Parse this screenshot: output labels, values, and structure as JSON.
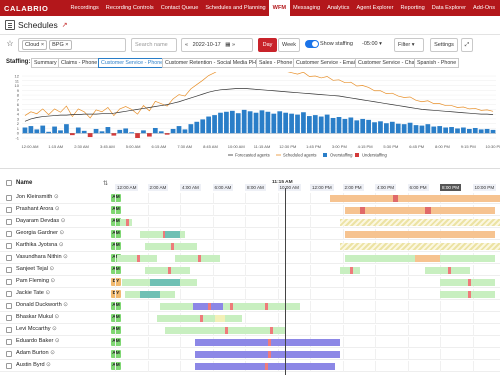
{
  "nav": {
    "logo": "CALABRIO",
    "items": [
      "Recordings",
      "Recording Controls",
      "Contact Queue",
      "Schedules and Planning",
      "WFM",
      "Messaging",
      "Analytics",
      "Agent Explorer",
      "Reporting",
      "Data Explorer",
      "Add-Ons"
    ],
    "active": "WFM"
  },
  "header": {
    "title": "Schedules",
    "ext_icon": "external-link-icon"
  },
  "toolbar": {
    "star": "☆",
    "timezone_filter": "Cloud",
    "chip_bpg": "BPG",
    "search_placeholder": "Search name",
    "date": "2022-10-17",
    "day_label": "Day",
    "week_label": "Week",
    "show_staffing_label": "Show staffing",
    "offset": "-05:00",
    "filter_label": "Filter",
    "settings_label": "Settings"
  },
  "staffing": {
    "label": "Staffing:",
    "tabs": [
      "Summary",
      "Claims - Phone",
      "Customer Service - Phone",
      "Customer Retention - Social Media PH",
      "Sales - Phone",
      "Customer Service - Email",
      "Customer Service - Chat",
      "Spanish - Phone"
    ],
    "active_tab": "Customer Service - Phone"
  },
  "chart_data": {
    "type": "bar",
    "y_ticks": [
      -1,
      0,
      1,
      2,
      3,
      4,
      5,
      6,
      7,
      8,
      9,
      10,
      11,
      12
    ],
    "ylim": [
      -1,
      12
    ],
    "x_ticks": [
      "12:00 AM",
      "1:15 AM",
      "2:30 AM",
      "3:45 AM",
      "5:00 AM",
      "6:15 AM",
      "7:30 AM",
      "8:45 AM",
      "10:00 AM",
      "11:15 AM",
      "12:30 PM",
      "1:45 PM",
      "3:00 PM",
      "4:15 PM",
      "5:30 PM",
      "6:45 PM",
      "8:00 PM",
      "9:15 PM",
      "10:30 PM"
    ],
    "legend": [
      "Forecasted agents",
      "Scheduled agents",
      "Overstaffing",
      "Understaffing"
    ],
    "colors": {
      "forecast": "#333333",
      "scheduled": "#e8902a",
      "over": "#2a7ec8",
      "under": "#d33a3a"
    },
    "forecast": [
      2.5,
      3,
      3.3,
      3.5,
      3.6,
      3.7,
      3.8,
      3.8,
      3.9,
      3.9,
      4,
      4,
      4,
      4.1,
      4.1,
      4.2,
      4.4,
      4.6,
      4.8,
      5,
      5.2,
      5.4,
      5.6,
      5.8,
      6,
      6.3,
      6.6,
      7,
      7.4,
      7.8,
      8.2,
      8.6,
      8.9,
      9.1,
      9.2,
      9.3,
      9.4,
      9.4,
      9.3,
      9.2,
      9.1,
      9,
      8.9,
      8.8,
      8.7,
      8.6,
      8.5,
      8.4,
      8.3,
      8.2,
      8.1,
      8,
      7.9,
      7.8,
      7.6,
      7.4,
      7.2,
      7,
      6.8,
      6.6,
      6.4,
      6.2,
      6,
      5.8,
      5.6,
      5.4,
      5.2,
      5,
      4.9,
      4.8,
      4.7,
      4.6,
      4.5,
      4.4,
      4.3,
      4.2,
      4.1,
      4,
      4,
      3.9
    ],
    "staffing_delta": [
      1.2,
      1.5,
      0.8,
      1.6,
      0.3,
      1.4,
      0.6,
      1.9,
      -0.4,
      1.2,
      0.5,
      -0.8,
      0.9,
      0.4,
      1.3,
      -0.5,
      0.7,
      1,
      0.2,
      -1,
      0.6,
      -0.7,
      1.1,
      0.4,
      -0.3,
      0.9,
      1.5,
      0.8,
      1.9,
      2.4,
      2.9,
      3.5,
      3.8,
      4.3,
      4.5,
      4.7,
      4.2,
      4.9,
      4.6,
      4.3,
      4.8,
      4.5,
      4.1,
      4.6,
      4.3,
      4.1,
      3.9,
      4.4,
      3.6,
      3.8,
      3.5,
      3.9,
      3.2,
      3.4,
      3,
      3.3,
      2.7,
      3,
      2.8,
      2.3,
      2.5,
      2.1,
      2.4,
      2,
      1.9,
      2.2,
      1.7,
      1.6,
      1.9,
      1.4,
      1.5,
      1.2,
      1.3,
      1,
      1.2,
      0.9,
      1.1,
      0.8,
      0.9,
      0.7
    ]
  },
  "grid": {
    "name_header": "Name",
    "current_time": "11:15 AM",
    "time_ticks": [
      {
        "label": "12:00 AM",
        "dark": false
      },
      {
        "label": "2:00 AM",
        "dark": false
      },
      {
        "label": "4:00 AM",
        "dark": false
      },
      {
        "label": "6:00 AM",
        "dark": false
      },
      {
        "label": "8:00 AM",
        "dark": false
      },
      {
        "label": "10:00 AM",
        "dark": false
      },
      {
        "label": "12:00 PM",
        "dark": false
      },
      {
        "label": "2:00 PM",
        "dark": false
      },
      {
        "label": "4:00 PM",
        "dark": false
      },
      {
        "label": "6:00 PM",
        "dark": false
      },
      {
        "label": "8:00 PM",
        "dark": false
      },
      {
        "label": "10:00 PM",
        "dark": false
      }
    ],
    "rows": [
      {
        "name": "Jon Kleinsmith",
        "badge": "AM",
        "segs": [
          [
            "b",
            330,
            150,
            "#f6c390"
          ],
          [
            "b",
            393,
            5,
            "#e06a6a"
          ],
          [
            "b",
            480,
            20,
            "#f6c390"
          ]
        ]
      },
      {
        "name": "Prashant Arora",
        "badge": "AM",
        "segs": [
          [
            "b",
            345,
            150,
            "#f6c390"
          ],
          [
            "b",
            360,
            5,
            "#e06a6a"
          ],
          [
            "b",
            425,
            6,
            "#e06a6a"
          ]
        ]
      },
      {
        "name": "Dayaram Devdas",
        "badge": "AM",
        "segs": [
          [
            "b",
            120,
            12,
            "#c8efc0"
          ],
          [
            "b",
            340,
            160,
            "#e8e1b0"
          ]
        ]
      },
      {
        "name": "Georgia Gardner",
        "badge": "AM",
        "segs": [
          [
            "b",
            140,
            45,
            "#c8efc0"
          ],
          [
            "b",
            165,
            15,
            "#6fc0b4"
          ],
          [
            "b",
            345,
            150,
            "#f6c390"
          ]
        ]
      },
      {
        "name": "Karthika Jyotsna",
        "badge": "AM",
        "segs": [
          [
            "b",
            145,
            52,
            "#c8efc0"
          ],
          [
            "b",
            340,
            160,
            "#e8e1b0"
          ]
        ]
      },
      {
        "name": "Vasundhara Nithin",
        "badge": "AM",
        "segs": [
          [
            "b",
            117,
            40,
            "#c8efc0"
          ],
          [
            "b",
            175,
            45,
            "#c8efc0"
          ],
          [
            "b",
            345,
            150,
            "#c8efc0"
          ],
          [
            "b",
            415,
            25,
            "#f6c390"
          ]
        ]
      },
      {
        "name": "Sanjeet Tejal",
        "badge": "AM",
        "segs": [
          [
            "b",
            145,
            45,
            "#c8efc0"
          ],
          [
            "b",
            340,
            20,
            "#c8efc0"
          ],
          [
            "b",
            425,
            45,
            "#c8efc0"
          ]
        ]
      },
      {
        "name": "Pam Fleming",
        "badge": "DY",
        "segs": [
          [
            "b",
            122,
            75,
            "#c8efc0"
          ],
          [
            "b",
            150,
            30,
            "#6fc0b4"
          ],
          [
            "b",
            440,
            55,
            "#c8efc0"
          ]
        ]
      },
      {
        "name": "Jackie Tate",
        "badge": "DY",
        "segs": [
          [
            "b",
            125,
            50,
            "#c8efc0"
          ],
          [
            "b",
            140,
            20,
            "#6fc0b4"
          ],
          [
            "b",
            440,
            55,
            "#c8efc0"
          ]
        ]
      },
      {
        "name": "Donald Duckworth",
        "badge": "AM",
        "segs": [
          [
            "b",
            160,
            140,
            "#c8efc0"
          ],
          [
            "b",
            193,
            30,
            "#8c87e6"
          ],
          [
            "b",
            240,
            50,
            "#c8efc0"
          ]
        ]
      },
      {
        "name": "Bhaskar Mukul",
        "badge": "AM",
        "segs": [
          [
            "b",
            157,
            85,
            "#c8efc0"
          ],
          [
            "b",
            215,
            10,
            "#f3f0b8"
          ]
        ]
      },
      {
        "name": "Levi Mccarthy",
        "badge": "AM",
        "segs": [
          [
            "b",
            165,
            120,
            "#c8efc0"
          ],
          [
            "b",
            260,
            20,
            "#c8efc0"
          ]
        ]
      },
      {
        "name": "Eduardo Baker",
        "badge": "AM",
        "segs": [
          [
            "b",
            195,
            145,
            "#8c87e6"
          ]
        ]
      },
      {
        "name": "Adam Burton",
        "badge": "AM",
        "segs": [
          [
            "b",
            195,
            145,
            "#8c87e6"
          ]
        ]
      },
      {
        "name": "Austin Byrd",
        "badge": "AM",
        "segs": [
          [
            "b",
            195,
            140,
            "#8c87e6"
          ]
        ]
      }
    ]
  }
}
